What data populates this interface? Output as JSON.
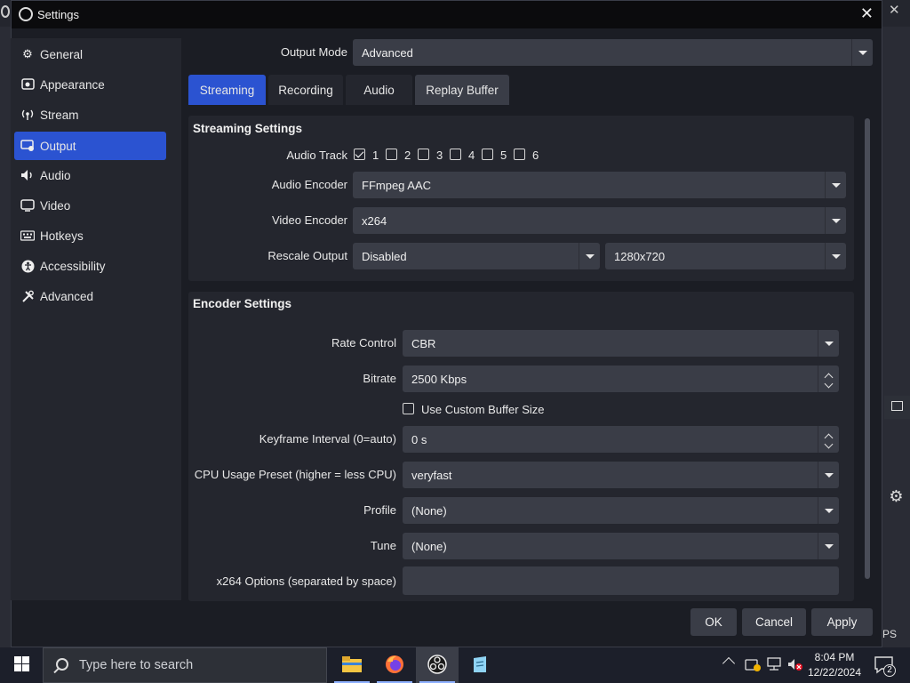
{
  "window": {
    "title": "Settings",
    "close_glyph": "✕"
  },
  "sidebar": {
    "items": [
      {
        "label": "General",
        "icon": "gear-icon"
      },
      {
        "label": "Appearance",
        "icon": "appearance-icon"
      },
      {
        "label": "Stream",
        "icon": "broadcast-icon"
      },
      {
        "label": "Output",
        "icon": "monitor-icon"
      },
      {
        "label": "Audio",
        "icon": "speaker-icon"
      },
      {
        "label": "Video",
        "icon": "screen-icon"
      },
      {
        "label": "Hotkeys",
        "icon": "keyboard-icon"
      },
      {
        "label": "Accessibility",
        "icon": "accessibility-icon"
      },
      {
        "label": "Advanced",
        "icon": "tools-icon"
      }
    ],
    "active": "Output"
  },
  "output_mode": {
    "label": "Output Mode",
    "value": "Advanced"
  },
  "tabs": [
    {
      "label": "Streaming"
    },
    {
      "label": "Recording"
    },
    {
      "label": "Audio"
    },
    {
      "label": "Replay Buffer"
    }
  ],
  "streaming": {
    "title": "Streaming Settings",
    "audio_track": {
      "label": "Audio Track",
      "tracks": [
        "1",
        "2",
        "3",
        "4",
        "5",
        "6"
      ],
      "checked": [
        true,
        false,
        false,
        false,
        false,
        false
      ]
    },
    "audio_encoder": {
      "label": "Audio Encoder",
      "value": "FFmpeg AAC"
    },
    "video_encoder": {
      "label": "Video Encoder",
      "value": "x264"
    },
    "rescale": {
      "label": "Rescale Output",
      "value": "Disabled",
      "resolution": "1280x720"
    }
  },
  "encoder": {
    "title": "Encoder Settings",
    "rate_control": {
      "label": "Rate Control",
      "value": "CBR"
    },
    "bitrate": {
      "label": "Bitrate",
      "value": "2500 Kbps"
    },
    "custom_buffer": {
      "label": "Use Custom Buffer Size",
      "checked": false
    },
    "keyframe": {
      "label": "Keyframe Interval (0=auto)",
      "value": "0 s"
    },
    "cpu_preset": {
      "label": "CPU Usage Preset (higher = less CPU)",
      "value": "veryfast"
    },
    "profile": {
      "label": "Profile",
      "value": "(None)"
    },
    "tune": {
      "label": "Tune",
      "value": "(None)"
    },
    "x264_options": {
      "label": "x264 Options (separated by space)",
      "value": ""
    }
  },
  "buttons": {
    "ok": "OK",
    "cancel": "Cancel",
    "apply": "Apply"
  },
  "taskbar": {
    "search_placeholder": "Type here to search",
    "time": "8:04 PM",
    "date": "12/22/2024",
    "notification_count": "2"
  },
  "background": {
    "fps_fragment": "PS"
  }
}
